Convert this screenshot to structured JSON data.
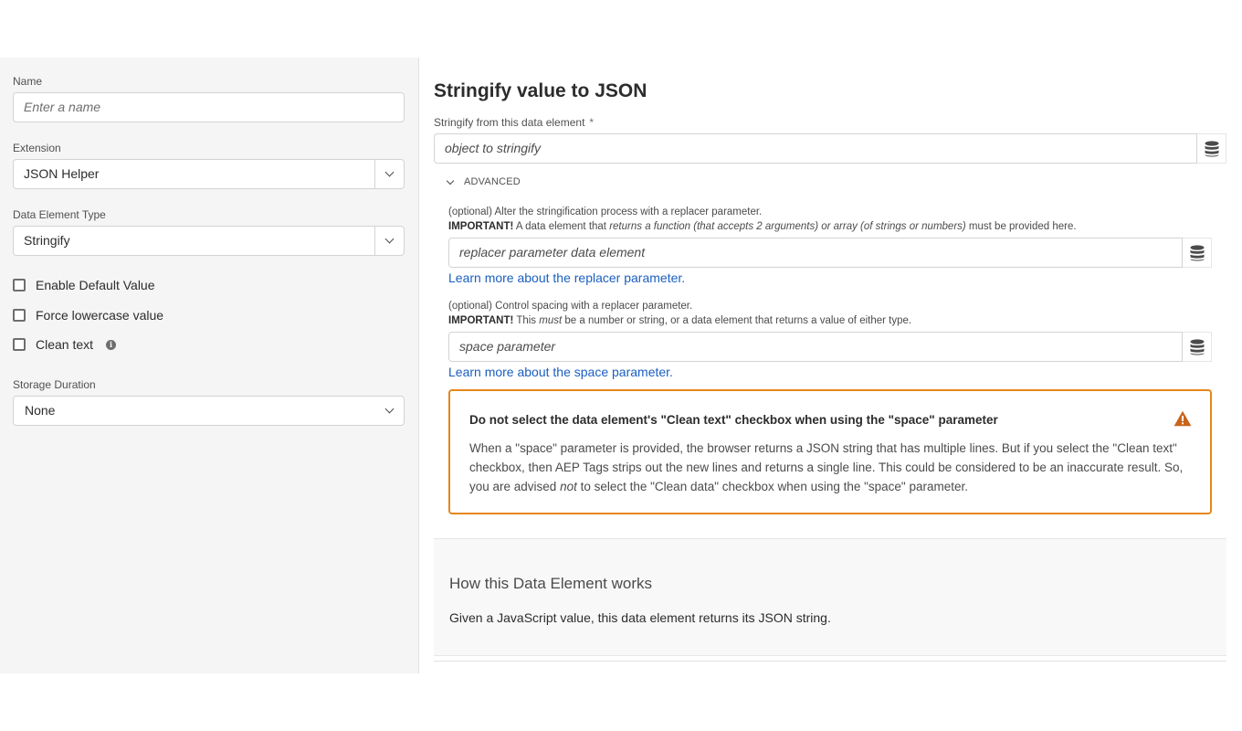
{
  "left": {
    "name": {
      "label": "Name",
      "placeholder": "Enter a name"
    },
    "extension": {
      "label": "Extension",
      "value": "JSON Helper"
    },
    "data_element_type": {
      "label": "Data Element Type",
      "value": "Stringify"
    },
    "checkboxes": [
      {
        "label": "Enable Default Value",
        "checked": false
      },
      {
        "label": "Force lowercase value",
        "checked": false
      },
      {
        "label": "Clean text",
        "checked": false
      }
    ],
    "info_icon_glyph": "i",
    "storage_duration": {
      "label": "Storage Duration",
      "value": "None"
    }
  },
  "main": {
    "title": "Stringify value to JSON",
    "source": {
      "label": "Stringify from this data element",
      "required_mark": "*",
      "placeholder": "object to stringify"
    },
    "advanced_label": "ADVANCED",
    "replacer": {
      "desc_line1": "(optional) Alter the stringification process with a replacer parameter.",
      "important": "IMPORTANT!",
      "desc_line2_a": " A data element that ",
      "desc_line2_em": "returns a function (that accepts 2 arguments) or array (of strings or numbers)",
      "desc_line2_b": " must be provided here.",
      "placeholder": "replacer parameter data element",
      "link": "Learn more about the replacer parameter."
    },
    "space": {
      "desc_line1": "(optional) Control spacing with a replacer parameter.",
      "important": "IMPORTANT!",
      "desc_line2_a": " This ",
      "desc_line2_em": "must",
      "desc_line2_b": " be a number or string, or a data element that returns a value of either type.",
      "placeholder": "space parameter",
      "link": "Learn more about the space parameter."
    },
    "alert": {
      "title": "Do not select the data element's \"Clean text\" checkbox when using the \"space\" parameter",
      "body_a": "When a \"space\" parameter is provided, the browser returns a JSON string that has multiple lines. But if you select the \"Clean text\" checkbox, then AEP Tags strips out the new lines and returns a single line. This could be considered to be an inaccurate result. So, you are advised ",
      "body_em": "not",
      "body_b": " to select the \"Clean data\" checkbox when using the \"space\" parameter.",
      "color": "#e68619"
    },
    "how": {
      "title": "How this Data Element works",
      "text": "Given a JavaScript value, this data element returns its JSON string."
    }
  },
  "colors": {
    "link": "#1a5fc0",
    "warning": "#e68619",
    "left_bg": "#f5f5f5"
  }
}
